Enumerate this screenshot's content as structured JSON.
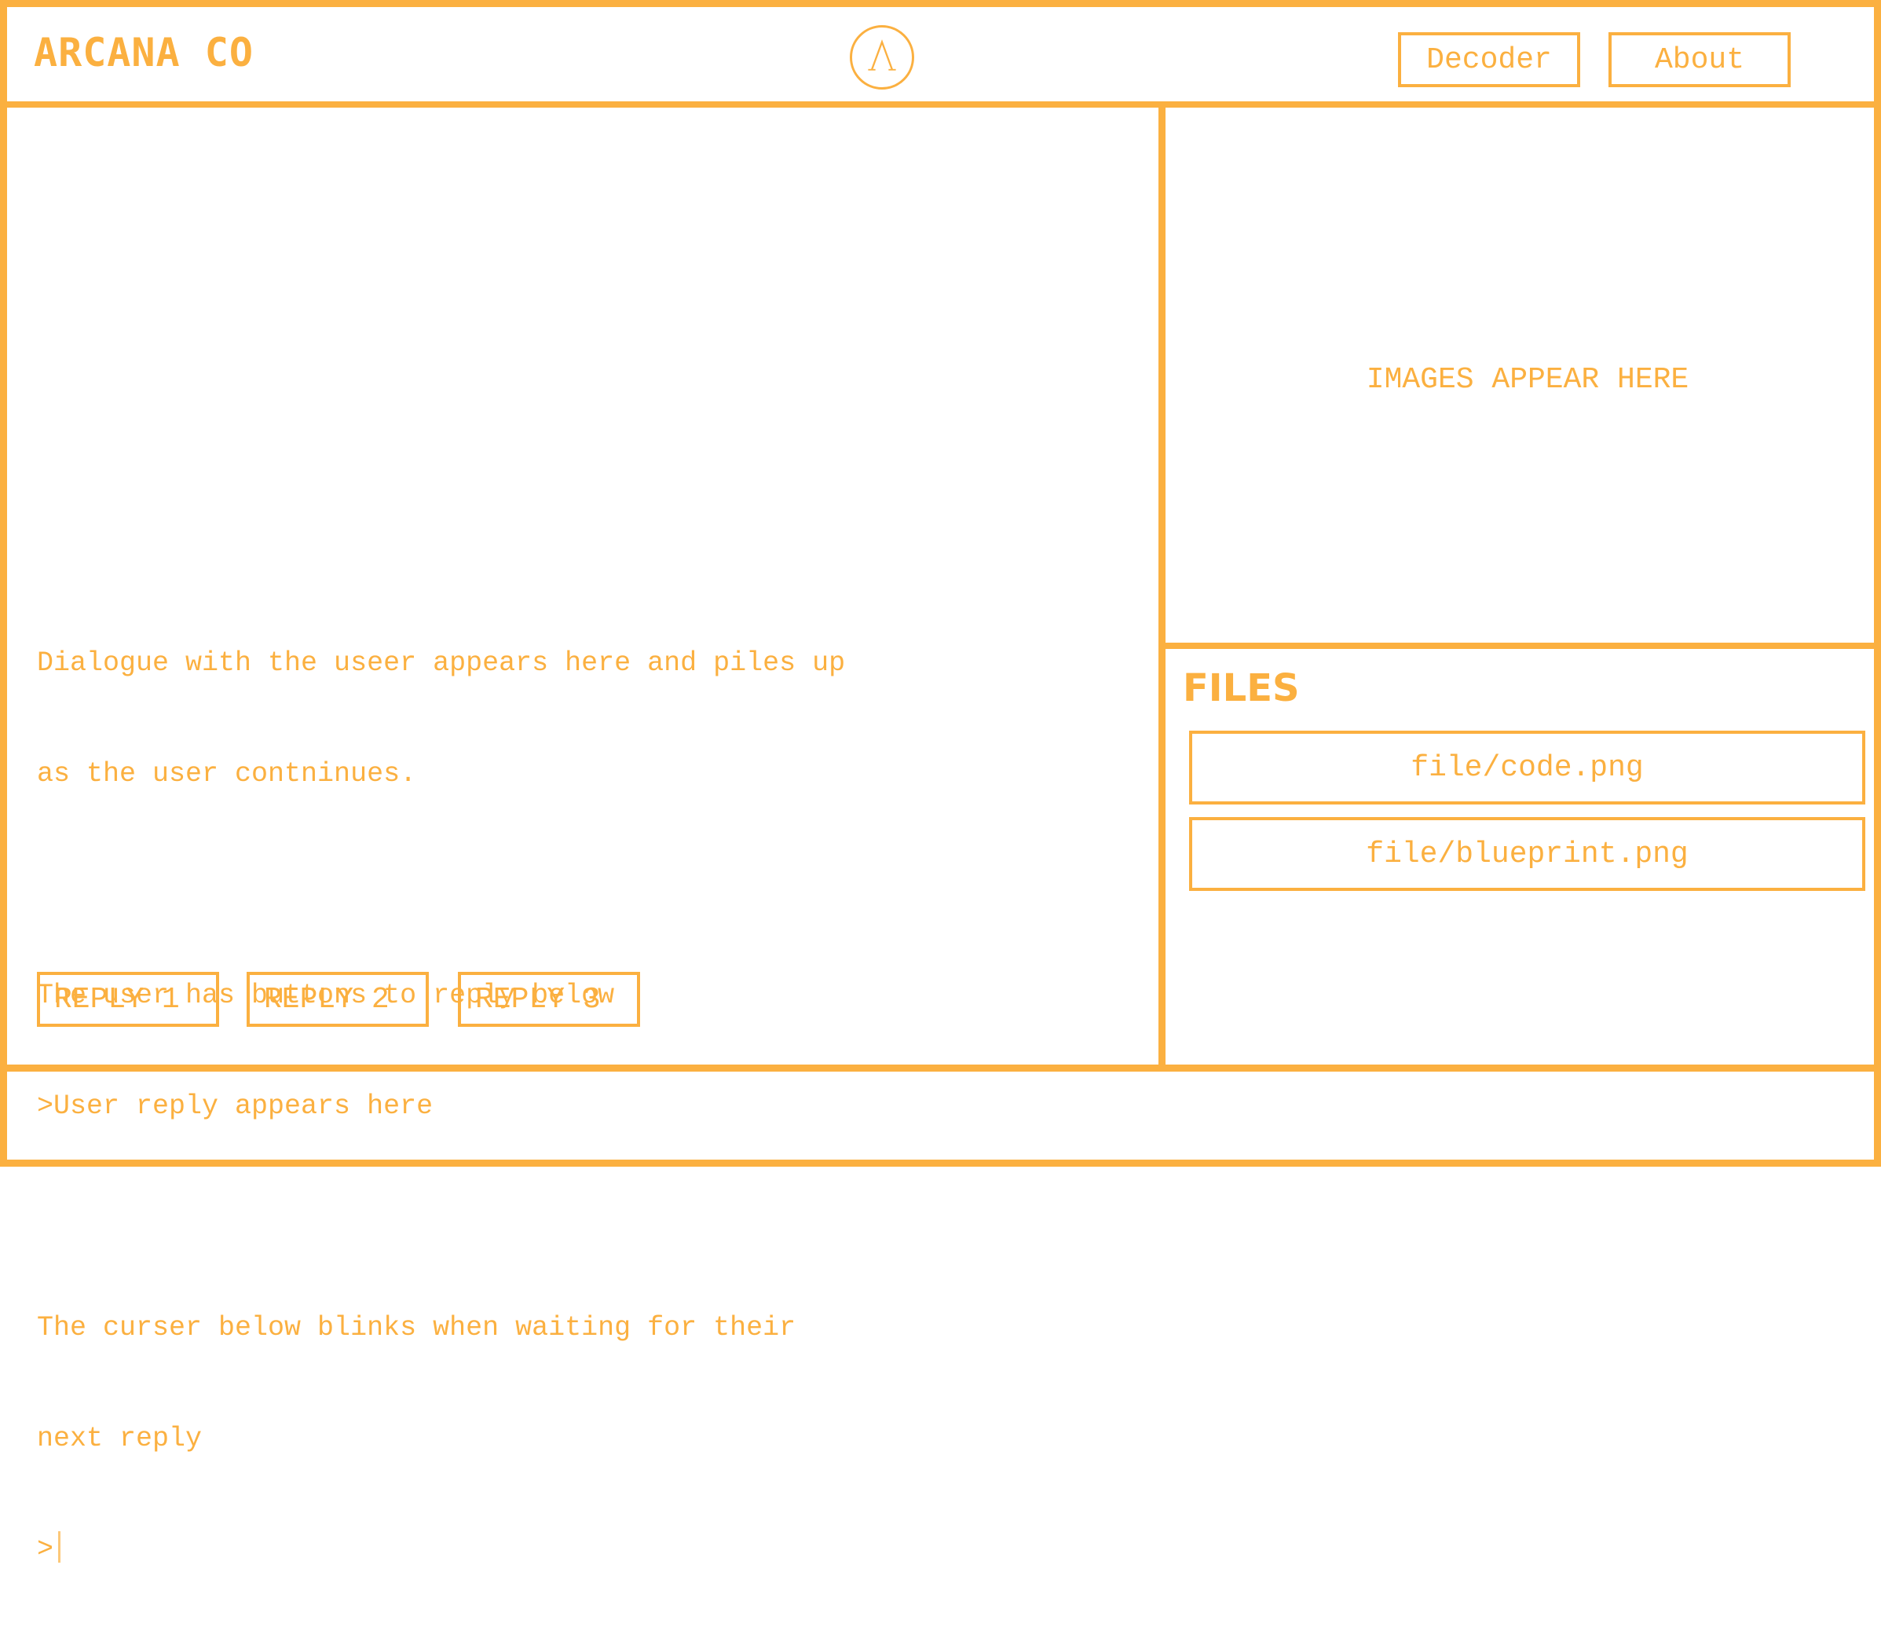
{
  "header": {
    "brand": "ARCANA CO",
    "logo_icon": "lambda-circle-icon",
    "nav": [
      {
        "label": "Decoder"
      },
      {
        "label": "About"
      }
    ]
  },
  "dialogue": {
    "lines": [
      "Dialogue with the useer appears here and piles up",
      "as the user contninues.",
      "",
      "The user has buttons to reply below",
      ">User reply appears here",
      "",
      "The curser below blinks when waiting for their",
      "next reply"
    ],
    "prompt": ">",
    "replies": [
      {
        "label": "REPLY 1"
      },
      {
        "label": "REPLY 2"
      },
      {
        "label": "REPLY 3"
      }
    ]
  },
  "images": {
    "placeholder": "IMAGES APPEAR HERE"
  },
  "files": {
    "title": "FILES",
    "items": [
      {
        "name": "file/code.png"
      },
      {
        "name": "file/blueprint.png"
      }
    ]
  },
  "colors": {
    "accent": "#FBB040",
    "background": "#FFFFFF"
  }
}
